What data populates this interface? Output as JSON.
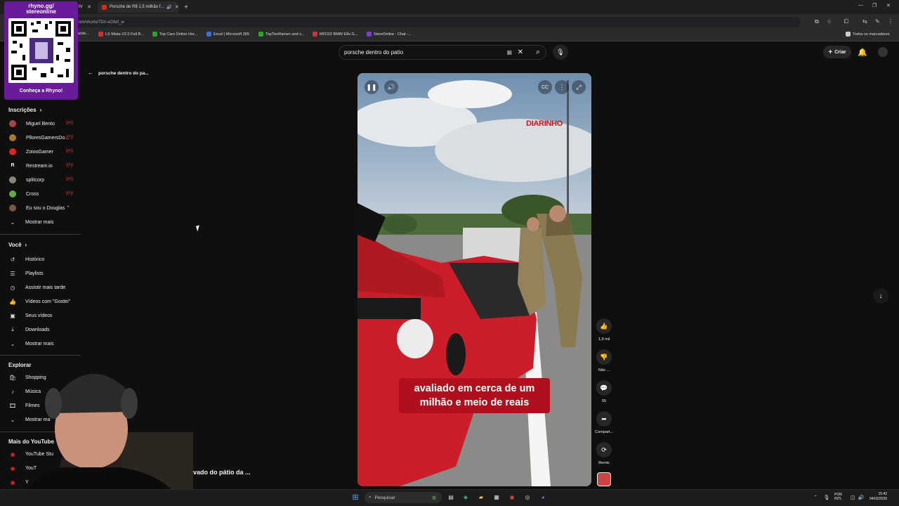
{
  "browser": {
    "tabs": [
      {
        "label": "tV",
        "active": false
      },
      {
        "label": "Porsche de R$ 1,5 milhão f...",
        "active": true
      }
    ],
    "new_tab_label": "+",
    "url": "om/shorts/7Dn-sO3of_w",
    "bookmarks": [
      "azda...",
      "LS Miata V2.0 Full B...",
      "Top Cars Online Hor...",
      "Excel | Microsoft 365",
      "TopTierRamen and s...",
      "MFD32 BMW E8x G...",
      "StereOnline - Chat -..."
    ],
    "bookmark_colors": [
      "#7a5",
      "#c33",
      "#2a2",
      "#227",
      "#2a2",
      "#c33",
      "#7a3ed6"
    ],
    "all_bookmarks": "Todos os marcadores"
  },
  "overlay": {
    "qr_title_line1": "rhyno.gg/",
    "qr_title_line2": "stereonline",
    "qr_cta": "Conheça a Rhyno!"
  },
  "header": {
    "search_value": "porsche dentro do patio",
    "create_label": "Criar"
  },
  "back_link": "porsche dentro do pa...",
  "sidebar": {
    "subscriptions_title": "Inscrições",
    "subscriptions": [
      {
        "label": "Miguel Bento",
        "color": "#a44"
      },
      {
        "label": "PlloresGamersDo...",
        "color": "#a73"
      },
      {
        "label": "ZoiooGamer",
        "color": "#d22"
      },
      {
        "label": "Restream.io",
        "color": "#000"
      },
      {
        "label": "splitcorp",
        "color": "#887"
      },
      {
        "label": "Cross",
        "color": "#6a4"
      },
      {
        "label": "Eu sou o Douglas",
        "color": "#754"
      }
    ],
    "show_more": "Mostrar mais",
    "you_title": "Você",
    "you_items": [
      "Histórico",
      "Playlists",
      "Assistir mais tarde",
      "Vídeos com \"Gostei\"",
      "Seus vídeos",
      "Downloads",
      "Mostrar mais"
    ],
    "explore_title": "Explorar",
    "explore_items": [
      "Shopping",
      "Música",
      "Filmes",
      "Mostrar ma"
    ],
    "more_title": "Mais do YouTube",
    "more_items": [
      "YouTube Stu",
      "YouT",
      "Y"
    ]
  },
  "video": {
    "brand": "DIARINHO",
    "caption_line1": "avaliado em cerca de um",
    "caption_line2": "milhão e meio de reais",
    "title_partial": "vado do pátio da ..."
  },
  "actions": {
    "likes": "1,9 mil",
    "dislike": "Não ...",
    "comments": "55",
    "share": "Compart...",
    "remix": "Remix"
  },
  "taskbar": {
    "search": "Pesquisar",
    "lang1": "POR",
    "lang2": "INTL",
    "time": "15:42",
    "date": "04/02/2026"
  }
}
